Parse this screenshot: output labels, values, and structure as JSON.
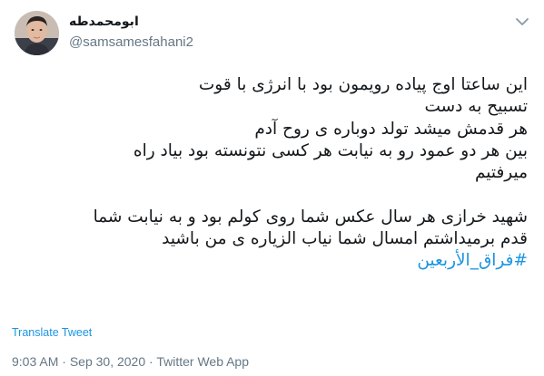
{
  "author": {
    "display_name": "ابومحمدطه",
    "handle": "@samsamesfahani2"
  },
  "tweet": {
    "lines": [
      "این ساعتا اوج پیاده رویمون بود با انرژی با قوت",
      "تسبیح به دست",
      "هر قدمش میشد تولد دوباره ی روح آدم",
      "بین هر دو عمود رو به نیابت هر کسی نتونسته بود بیاد راه",
      "میرفتیم",
      "",
      "شهید خرازی هر سال عکس شما روی کولم بود و به نیابت شما",
      "قدم برمیداشتم امسال شما نیاب الزیاره ی من باشید"
    ],
    "hashtag": "#فراق_الأربعین"
  },
  "actions": {
    "translate_label": "Translate Tweet",
    "more_icon": "chevron-down-icon"
  },
  "meta": {
    "time": "9:03 AM",
    "separator": "·",
    "date": "Sep 30, 2020",
    "source": "Twitter Web App"
  },
  "colors": {
    "link": "#1b95e0",
    "secondary_text": "#657786",
    "primary_text": "#14171a"
  }
}
